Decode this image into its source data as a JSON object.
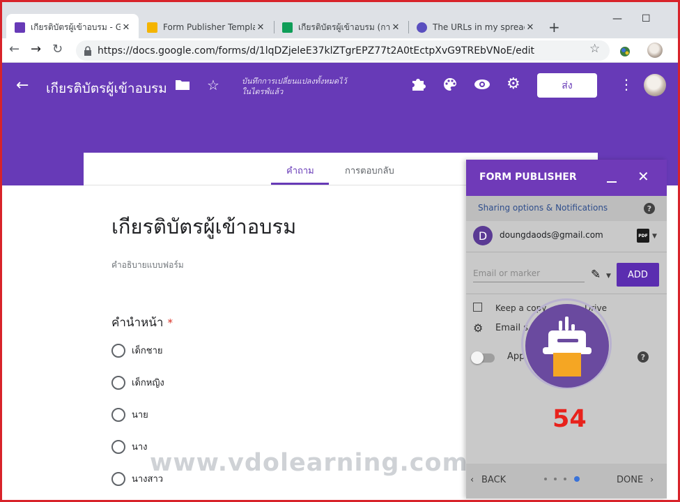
{
  "browser": {
    "tabs": [
      {
        "title": "เกียรติบัตรผู้เข้าอบรม - Goog",
        "favicon_color": "#673ab7"
      },
      {
        "title": "Form Publisher Template",
        "favicon_color": "#f4b400"
      },
      {
        "title": "เกียรติบัตรผู้เข้าอบรม (การตอ",
        "favicon_color": "#0f9d58"
      },
      {
        "title": "The URLs in my spreadsh",
        "favicon_color": "#5a4fbf"
      }
    ],
    "new_tab_label": "+",
    "url": "https://docs.google.com/forms/d/1lqDZjeleE37klZTgrEPZ77t2A0tEctpXvG9TREbVNoE/edit"
  },
  "forms_header": {
    "title": "เกียรติบัตรผู้เข้าอบรม",
    "saved_status": "บันทึกการเปลี่ยนแปลงทั้งหมดไว้\nในไดรฟ์แล้ว",
    "send_label": "ส่ง",
    "brand_color": "#673ab7"
  },
  "form_tabs": {
    "questions": "คำถาม",
    "responses": "การตอบกลับ"
  },
  "form": {
    "title": "เกียรติบัตรผู้เข้าอบรม",
    "description": "คำอธิบายแบบฟอร์ม",
    "question": {
      "title": "คำนำหน้า",
      "required_mark": "*",
      "options": [
        "เด็กชาย",
        "เด็กหญิง",
        "นาย",
        "นาง",
        "นางสาว"
      ]
    }
  },
  "watermark": "www.vdolearning.com",
  "form_publisher": {
    "title": "FORM PUBLISHER",
    "sub_header": "Sharing options & Notifications",
    "help_label": "?",
    "account_initial": "D",
    "account_email": "doungdaods@gmail.com",
    "file_format_icon": "PDF",
    "email_placeholder": "Email or marker",
    "add_label": "ADD",
    "keep_copy_left": "Keep a copy",
    "keep_copy_right": "Drive",
    "email_settings_label": "Email s",
    "approval_label": "App",
    "loading_count": "54",
    "back_label": "BACK",
    "done_label": "DONE",
    "accent_color": "#6f3ab8"
  }
}
